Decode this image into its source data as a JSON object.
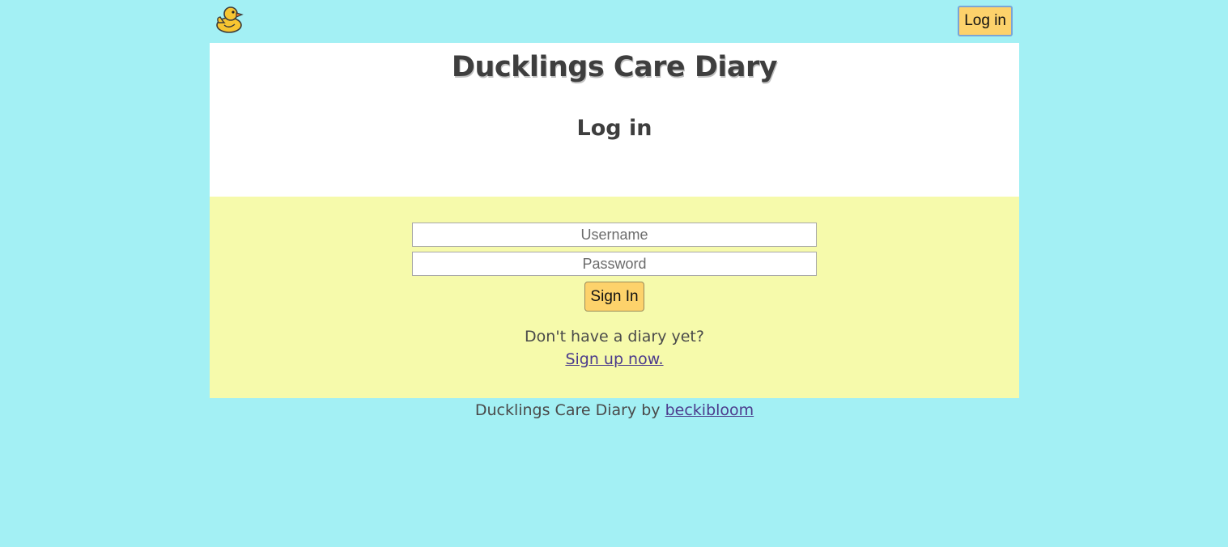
{
  "header": {
    "logo_icon": "duck-icon",
    "login_label": "Log in"
  },
  "hero": {
    "site_title": "Ducklings Care Diary",
    "page_heading": "Log in"
  },
  "form": {
    "username_placeholder": "Username",
    "username_value": "",
    "password_placeholder": "Password",
    "password_value": "",
    "signin_label": "Sign In",
    "prompt": "Don't have a diary yet?",
    "signup_link": "Sign up now."
  },
  "footer": {
    "text": "Ducklings Care Diary by",
    "author_link": "beckibloom"
  },
  "colors": {
    "page_bg": "#a3f0f4",
    "hero_bg": "#ffffff",
    "form_bg": "#f6faab",
    "button_bg": "#fdd26b",
    "link": "#4b3a8c"
  }
}
